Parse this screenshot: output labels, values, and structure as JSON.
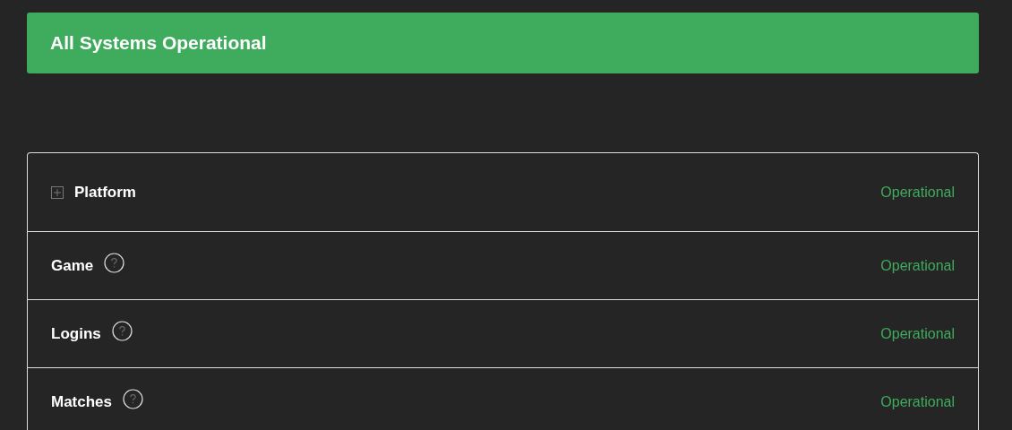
{
  "banner": {
    "title": "All Systems Operational"
  },
  "components": [
    {
      "kind": "group",
      "name": "Platform",
      "expanded": false,
      "status": "Operational"
    },
    {
      "kind": "component",
      "name": "Game",
      "status": "Operational"
    },
    {
      "kind": "component",
      "name": "Logins",
      "status": "Operational"
    },
    {
      "kind": "component",
      "name": "Matches",
      "status": "Operational"
    }
  ]
}
